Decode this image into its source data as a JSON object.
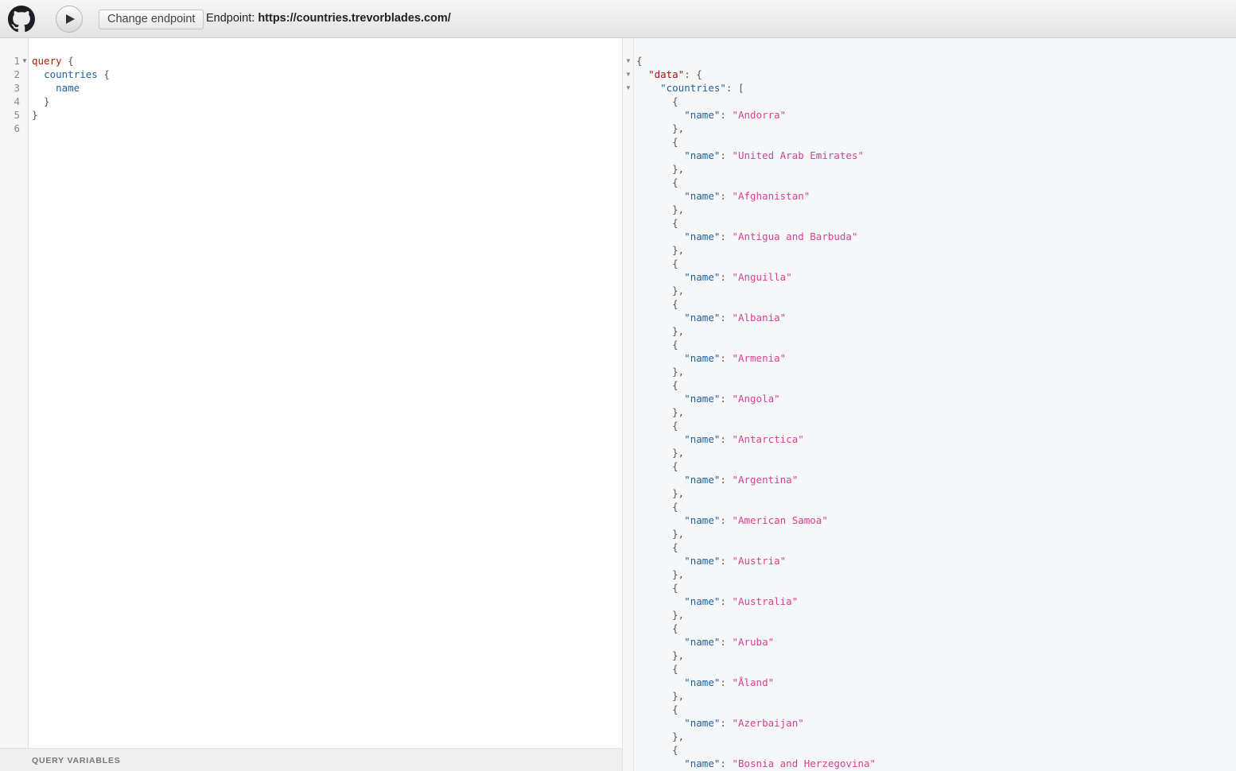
{
  "toolbar": {
    "change_endpoint_label": "Change endpoint",
    "endpoint_prefix": "Endpoint:",
    "endpoint_url": "https://countries.trevorblades.com/"
  },
  "editor": {
    "line_numbers": [
      "1",
      "2",
      "3",
      "4",
      "5",
      "6"
    ],
    "query_keyword": "query",
    "field_countries": "countries",
    "field_name": "name"
  },
  "query_variables_label": "QUERY VARIABLES",
  "result": {
    "data_key": "\"data\"",
    "countries_key": "\"countries\"",
    "name_key": "\"name\"",
    "countries": [
      "Andorra",
      "United Arab Emirates",
      "Afghanistan",
      "Antigua and Barbuda",
      "Anguilla",
      "Albania",
      "Armenia",
      "Angola",
      "Antarctica",
      "Argentina",
      "American Samoa",
      "Austria",
      "Australia",
      "Aruba",
      "Åland",
      "Azerbaijan",
      "Bosnia and Herzegovina"
    ]
  },
  "icons": {
    "github": "github-icon",
    "run": "play-icon"
  },
  "colors": {
    "keyword": "#b11a04",
    "field": "#1f61a0",
    "string": "#d64292"
  }
}
